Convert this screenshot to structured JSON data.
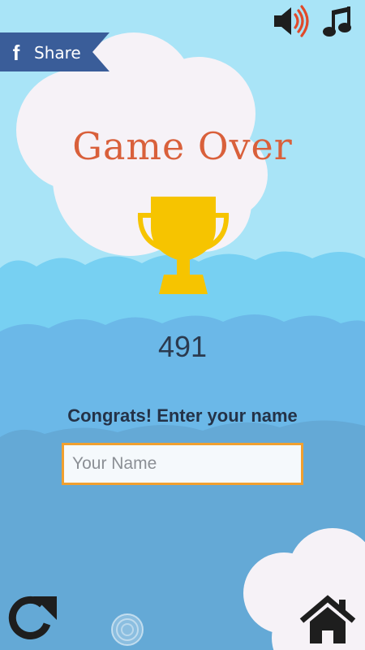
{
  "share": {
    "label": "Share",
    "icon_glyph": "f",
    "icon": "facebook-icon"
  },
  "top_bar": {
    "sound_icon": "speaker-volume-icon",
    "music_icon": "music-note-icon"
  },
  "title": "Game Over",
  "trophy_icon": "trophy-icon",
  "score": "491",
  "prompt": "Congrats! Enter your name",
  "name_input": {
    "placeholder": "Your Name",
    "value": ""
  },
  "bottom_bar": {
    "restart_icon": "restart-icon",
    "home_icon": "home-icon"
  },
  "colors": {
    "sky": "#a9e4f7",
    "cloud": "#f6f2f7",
    "title": "#d9603b",
    "trophy": "#f6c400",
    "share_banner": "#3a5d99",
    "input_border": "#f0a030",
    "text_dark": "#243247"
  }
}
